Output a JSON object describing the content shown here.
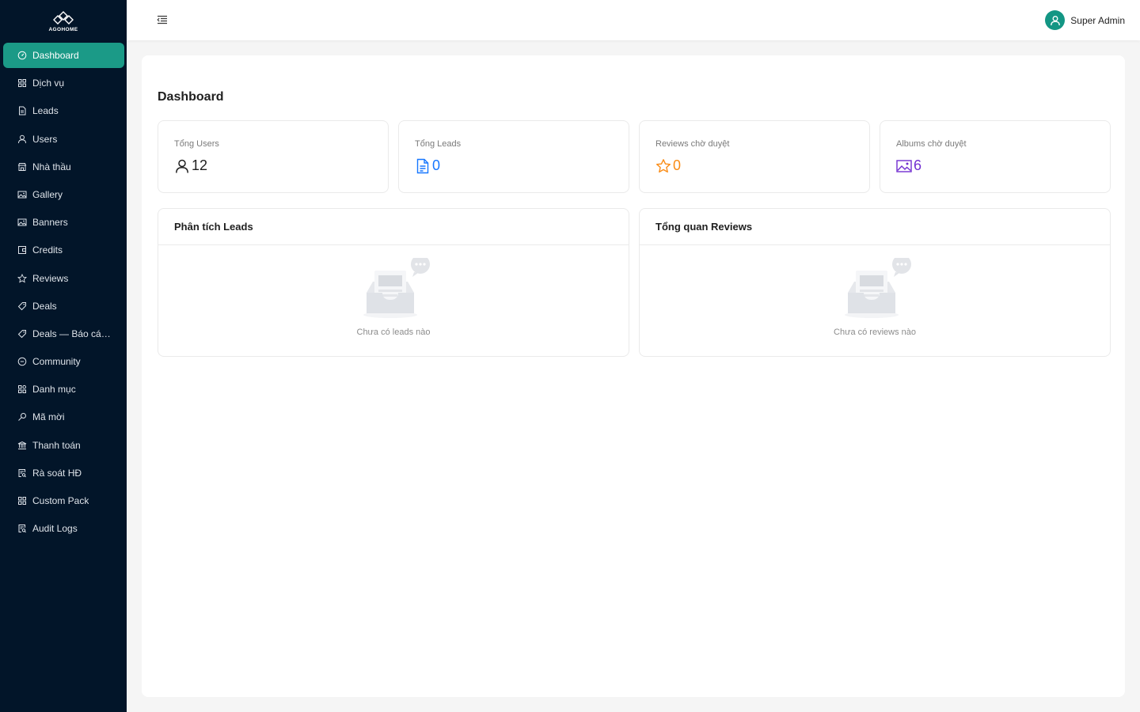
{
  "brand": {
    "name": "AGOHOME",
    "accent": "#1b9a87",
    "sidebar_bg": "#021529"
  },
  "sidebar": {
    "items": [
      {
        "label": "Dashboard",
        "icon": "dashboard-icon",
        "active": true
      },
      {
        "label": "Dịch vụ",
        "icon": "grid-icon"
      },
      {
        "label": "Leads",
        "icon": "file-icon"
      },
      {
        "label": "Users",
        "icon": "user-icon"
      },
      {
        "label": "Nhà thầu",
        "icon": "shop-icon"
      },
      {
        "label": "Gallery",
        "icon": "picture-icon"
      },
      {
        "label": "Banners",
        "icon": "picture-icon"
      },
      {
        "label": "Credits",
        "icon": "wallet-icon"
      },
      {
        "label": "Reviews",
        "icon": "star-icon"
      },
      {
        "label": "Deals",
        "icon": "tag-icon"
      },
      {
        "label": "Deals — Báo cáo ...",
        "icon": "tag-icon"
      },
      {
        "label": "Community",
        "icon": "message-icon"
      },
      {
        "label": "Danh mục",
        "icon": "category-icon"
      },
      {
        "label": "Mã mời",
        "icon": "key-icon"
      },
      {
        "label": "Thanh toán",
        "icon": "bank-icon"
      },
      {
        "label": "Rà soát HĐ",
        "icon": "audit-icon"
      },
      {
        "label": "Custom Pack",
        "icon": "grid-icon"
      },
      {
        "label": "Audit Logs",
        "icon": "audit-icon"
      }
    ]
  },
  "header": {
    "user_name": "Super Admin",
    "toggle_icon": "menu-fold-icon",
    "avatar_icon": "user-icon"
  },
  "main": {
    "title": "Dashboard",
    "stats": [
      {
        "label": "Tổng Users",
        "value": "12",
        "icon": "user-icon",
        "color": "#1f1f1f"
      },
      {
        "label": "Tổng Leads",
        "value": "0",
        "icon": "file-text-icon",
        "color": "#1677ff"
      },
      {
        "label": "Reviews chờ duyệt",
        "value": "0",
        "icon": "star-icon",
        "color": "#fa8c16"
      },
      {
        "label": "Albums chờ duyệt",
        "value": "6",
        "icon": "picture-icon",
        "color": "#722ed1"
      }
    ],
    "panels": [
      {
        "title": "Phân tích Leads",
        "empty_text": "Chưa có leads nào"
      },
      {
        "title": "Tổng quan Reviews",
        "empty_text": "Chưa có reviews nào"
      }
    ]
  }
}
